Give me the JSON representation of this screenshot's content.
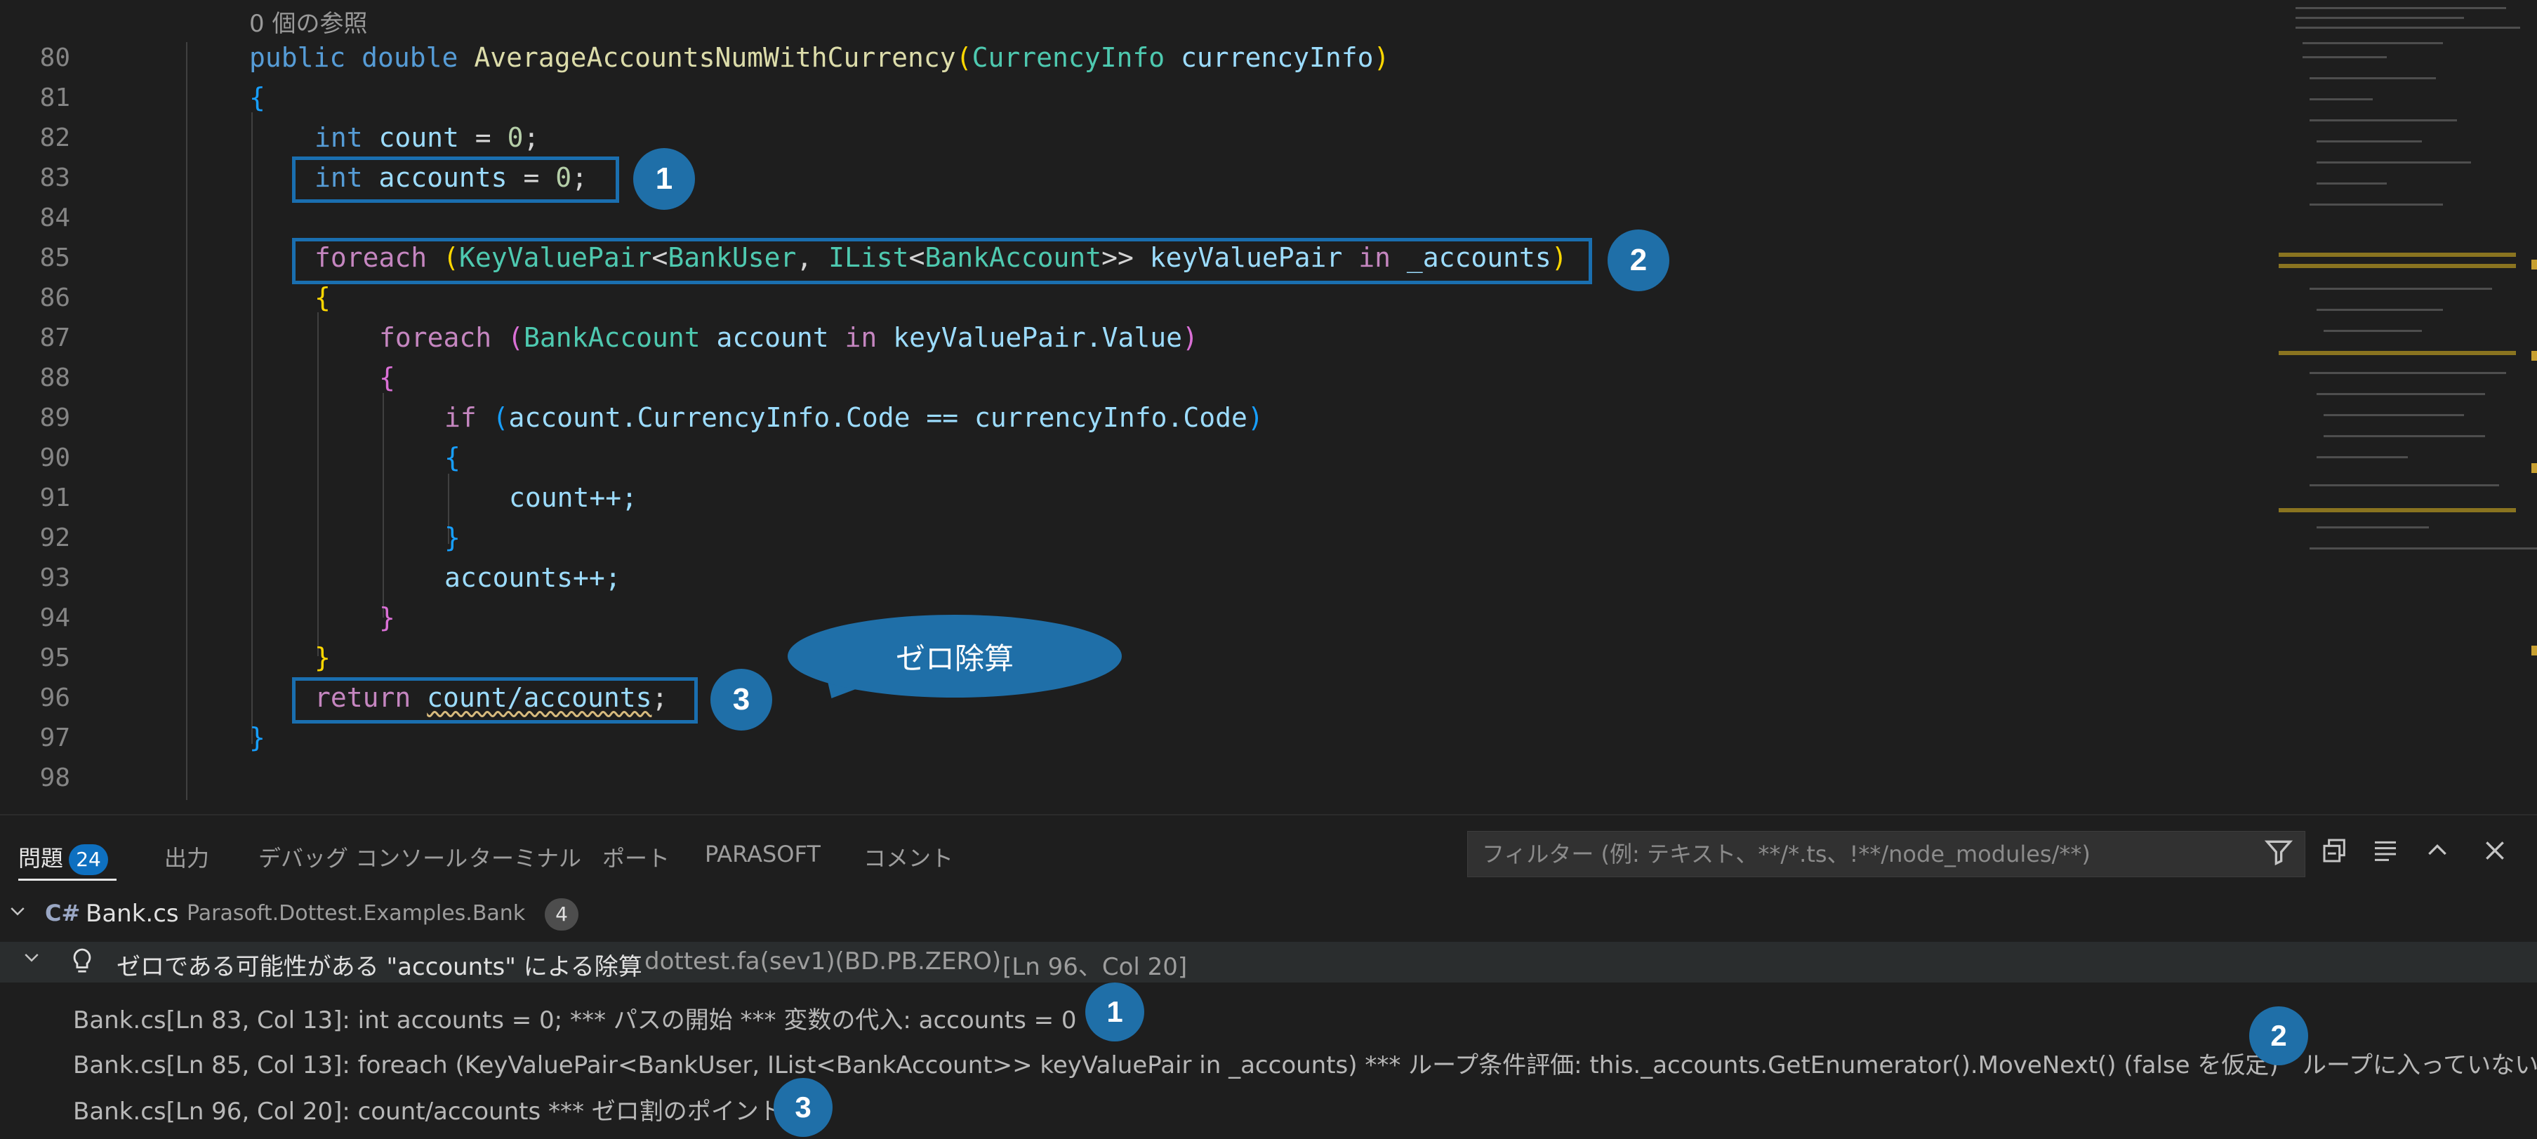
{
  "editor": {
    "codelens": "0 個の参照",
    "line_numbers": [
      "80",
      "81",
      "82",
      "83",
      "84",
      "85",
      "86",
      "87",
      "88",
      "89",
      "90",
      "91",
      "92",
      "93",
      "94",
      "95",
      "96",
      "97",
      "98"
    ],
    "code": {
      "l80_kw1": "public",
      "l80_kw2": "double",
      "l80_fn": "AverageAccountsNumWithCurrency",
      "l80_open": "(",
      "l80_type": "CurrencyInfo",
      "l80_param": "currencyInfo",
      "l80_close": ")",
      "l81": "{",
      "l82_kw": "int",
      "l82_var": "count",
      "l82_eq": " = ",
      "l82_num": "0",
      "l82_semi": ";",
      "l83_kw": "int",
      "l83_var": "accounts",
      "l83_eq": " = ",
      "l83_num": "0",
      "l83_semi": ";",
      "l85_kw": "foreach",
      "l85_open": "(",
      "l85_t1": "KeyValuePair",
      "l85_lt": "<",
      "l85_t2": "BankUser",
      "l85_comma": ", ",
      "l85_t3": "IList",
      "l85_lt2": "<",
      "l85_t4": "BankAccount",
      "l85_gt": ">>",
      "l85_var": "keyValuePair",
      "l85_in": "in",
      "l85_src": "_accounts",
      "l85_close": ")",
      "l86": "{",
      "l87_kw": "foreach",
      "l87_open": "(",
      "l87_type": "BankAccount",
      "l87_var": "account",
      "l87_in": "in",
      "l87_src": "keyValuePair.Value",
      "l87_close": ")",
      "l88": "{",
      "l89_kw": "if",
      "l89_open": "(",
      "l89_expr": "account.CurrencyInfo.Code == currencyInfo.Code",
      "l89_close": ")",
      "l90": "{",
      "l91": "count++;",
      "l92": "}",
      "l93": "accounts++;",
      "l94": "}",
      "l95": "}",
      "l96_kw": "return",
      "l96_expr": "count/accounts",
      "l96_semi": ";",
      "l97": "}"
    },
    "markers": [
      "1",
      "2",
      "3"
    ],
    "callout": "ゼロ除算"
  },
  "panel": {
    "tabs": [
      {
        "label": "問題",
        "badge": "24"
      },
      {
        "label": "出力"
      },
      {
        "label": "デバッグ コンソール"
      },
      {
        "label": "ターミナル"
      },
      {
        "label": "ポート"
      },
      {
        "label": "PARASOFT"
      },
      {
        "label": "コメント"
      }
    ],
    "filter_placeholder": "フィルター (例: テキスト、**/*.ts、!**/node_modules/**)",
    "icons": [
      "filter-icon",
      "collapse-all-icon",
      "view-as-list-icon",
      "maximize-panel-icon",
      "close-panel-icon"
    ],
    "file": {
      "name": "Bank.cs",
      "path": "Parasoft.Dottest.Examples.Bank",
      "count": "4"
    },
    "problem": {
      "message": "ゼロである可能性がある \"accounts\" による除算",
      "source": "dottest.fa(sev1)(BD.PB.ZERO)",
      "location": "[Ln 96、Col 20]"
    },
    "details": [
      {
        "text": "Bank.cs[Ln 83, Col 13]: int accounts = 0; *** パスの開始 *** 変数の代入: accounts = 0",
        "marker": "1"
      },
      {
        "text": "Bank.cs[Ln 85, Col 13]: foreach (KeyValuePair<BankUser, IList<BankAccount>> keyValuePair in _accounts) *** ループ条件評価: this._accounts.GetEnumerator().MoveNext() (false を仮定)",
        "marker": "2",
        "suffix": "ループに入っていない"
      },
      {
        "text": "Bank.cs[Ln 96, Col 20]: count/accounts *** ゼロ割のポイント",
        "marker": "3"
      }
    ]
  },
  "colors": {
    "accent": "#1f6fa8",
    "badge": "#0e70c0",
    "background": "#1e1e1e"
  }
}
